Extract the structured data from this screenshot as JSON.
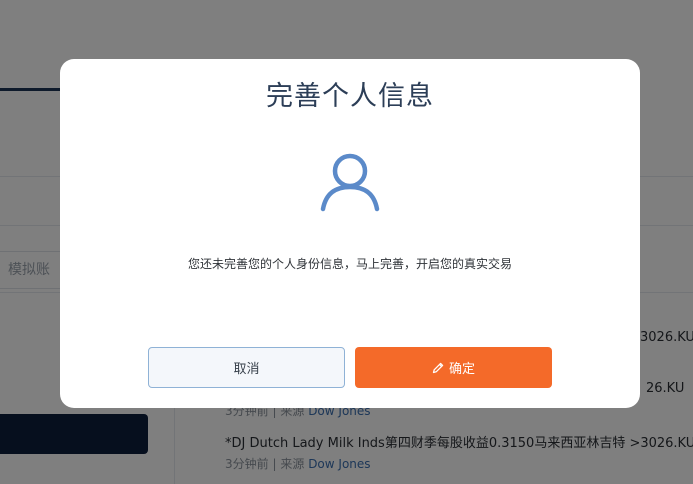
{
  "background": {
    "account_input_text": "模拟账",
    "news": [
      {
        "title": "*DJ Dutch Lady Milk Inds第四财季每股收益0.3150马来西亚林吉特 >3026.KU",
        "time": "3分钟前",
        "separator": "|",
        "source_prefix": "来源",
        "source": "Dow Jones"
      }
    ],
    "clipped_right_texts": [
      "3026.KU",
      "26.KU"
    ],
    "clipped_meta": {
      "time": "3分钟前",
      "separator": "|",
      "source_prefix": "来源",
      "source": "Dow Jones"
    }
  },
  "modal": {
    "title": "完善个人信息",
    "icon": "user-icon",
    "message": "您还未完善您的个人身份信息，马上完善，开启您的真实交易",
    "cancel_label": "取消",
    "confirm_label": "确定",
    "confirm_icon": "pencil-icon"
  },
  "colors": {
    "accent": "#f46a29",
    "icon_blue": "#5b8ac9",
    "title": "#2c3e57",
    "cancel_border": "#8fb2d6"
  }
}
